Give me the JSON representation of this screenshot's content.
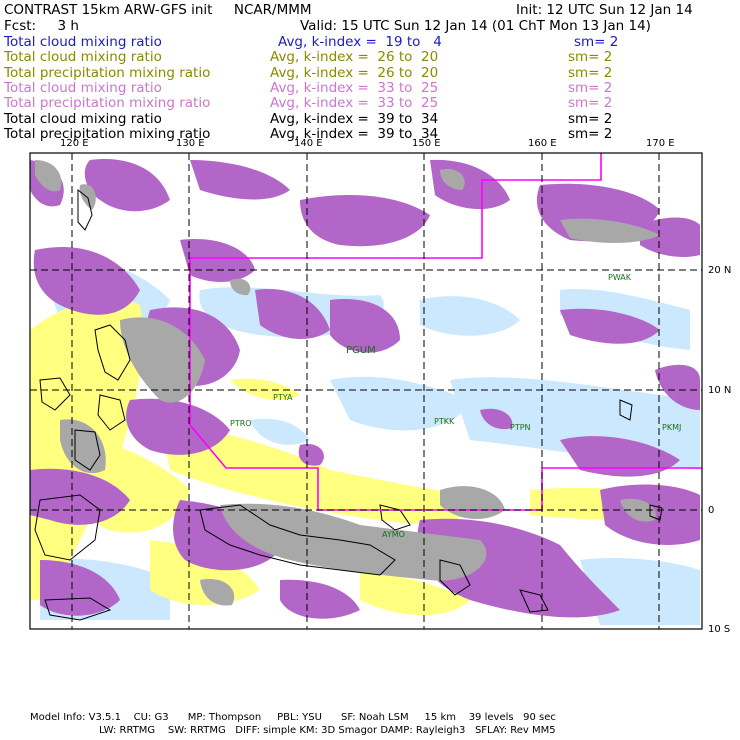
{
  "header": {
    "title": "CONTRAST 15km ARW-GFS init     NCAR/MMM",
    "init": "Init: 12 UTC Sun 12 Jan 14",
    "fcst": "Fcst:     3 h",
    "valid": "Valid: 15 UTC Sun 12 Jan 14 (01 ChT Mon 13 Jan 14)"
  },
  "legend": [
    {
      "name": "Total cloud mixing ratio",
      "stat": "Avg, k-index =  19 to   4",
      "sm": "sm= 2",
      "color": "#1a1acc"
    },
    {
      "name": "Total cloud mixing ratio",
      "stat": "Avg, k-index =  26 to  20",
      "sm": "sm= 2",
      "color": "#8a8a00"
    },
    {
      "name": "Total precipitation mixing ratio",
      "stat": "Avg, k-index =  26 to  20",
      "sm": "sm= 2",
      "color": "#8a8a00"
    },
    {
      "name": "Total cloud mixing ratio",
      "stat": "Avg, k-index =  33 to  25",
      "sm": "sm= 2",
      "color": "#cc77cc"
    },
    {
      "name": "Total precipitation mixing ratio",
      "stat": "Avg, k-index =  33 to  25",
      "sm": "sm= 2",
      "color": "#cc77cc"
    },
    {
      "name": "Total cloud mixing ratio",
      "stat": "Avg, k-index =  39 to  34",
      "sm": "sm= 2",
      "color": "#000000"
    },
    {
      "name": "Total precipitation mixing ratio",
      "stat": "Avg, k-index =  39 to  34",
      "sm": "sm= 2",
      "color": "#000000"
    }
  ],
  "axes": {
    "lon_labels": [
      "120 E",
      "130 E",
      "140 E",
      "150 E",
      "160 E",
      "170 E"
    ],
    "lat_labels": [
      "20 N",
      "10 N",
      "0",
      "10 S"
    ]
  },
  "stations": [
    "PGUM",
    "PTYA",
    "PTRO",
    "PTKK",
    "PTPN",
    "PKMJ",
    "PWAK",
    "AYMO"
  ],
  "colors": {
    "cloud_purple": "#b266c8",
    "gray": "#a8a8a8",
    "yellow": "#ffff80",
    "lightblue": "#cce8ff",
    "domain_line": "#ff00ff"
  },
  "footer": {
    "line1": "Model Info: V3.5.1    CU: G3      MP: Thompson     PBL: YSU      SF: Noah LSM     15 km    39 levels   90 sec",
    "line2": "LW: RRTMG    SW: RRTMG   DIFF: simple KM: 3D Smagor DAMP: Rayleigh3   SFLAY: Rev MM5"
  }
}
